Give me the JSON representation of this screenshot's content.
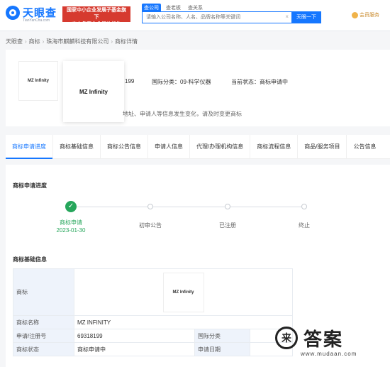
{
  "header": {
    "logo_text": "天眼查",
    "logo_sub": "TianYanCha.com",
    "promo_line1": "国家中小企业发展子基金旗下",
    "promo_line2": "官方备案企业征信机构",
    "search_tabs": [
      "查公司",
      "查老板",
      "查关系"
    ],
    "search_placeholder": "请输入公司名称、人名、品牌名称等关键词",
    "search_clear": "×",
    "search_button": "天眼一下",
    "vip_label": "会员服务"
  },
  "breadcrumb": [
    "天眼查",
    "商标",
    "珠海市麒麟科技有限公司",
    "商标详情"
  ],
  "summary": {
    "reg_no_partial": "199",
    "intl_class": "国际分类：09-科学仪器",
    "status": "当前状态：商标申请中",
    "note_partial": "地址、申请人等信息发生变化，请及时变更商标",
    "mark_text": "MZ Infinity",
    "mark_text_small": "MZ Infinity"
  },
  "tabs": [
    "商标申请进度",
    "商标基础信息",
    "商标公告信息",
    "申请人信息",
    "代理/办理机构信息",
    "商标流程信息",
    "商品/服务项目",
    "公告信息"
  ],
  "progress": {
    "title": "商标申请进度",
    "steps": [
      {
        "label": "商标申请",
        "date": "2023-01-30",
        "done": true
      },
      {
        "label": "初审公告",
        "date": "",
        "done": false
      },
      {
        "label": "已注册",
        "date": "",
        "done": false
      },
      {
        "label": "终止",
        "date": "",
        "done": false
      }
    ],
    "check": "✓"
  },
  "basic_info": {
    "title": "商标基础信息",
    "rows": [
      {
        "key": "商标",
        "value": ""
      },
      {
        "key": "商标名称",
        "value": "MZ INFINITY"
      },
      {
        "key": "申请/注册号",
        "value": "69318199",
        "key2": "国际分类",
        "value2": ""
      },
      {
        "key": "商标状态",
        "value": "商标申请中",
        "key2": "申请日期",
        "value2": ""
      }
    ],
    "tm_image_text": "MZ Infinity"
  },
  "watermark": {
    "glyph": "来",
    "text": "答案",
    "url": "www.mudaan.com"
  }
}
